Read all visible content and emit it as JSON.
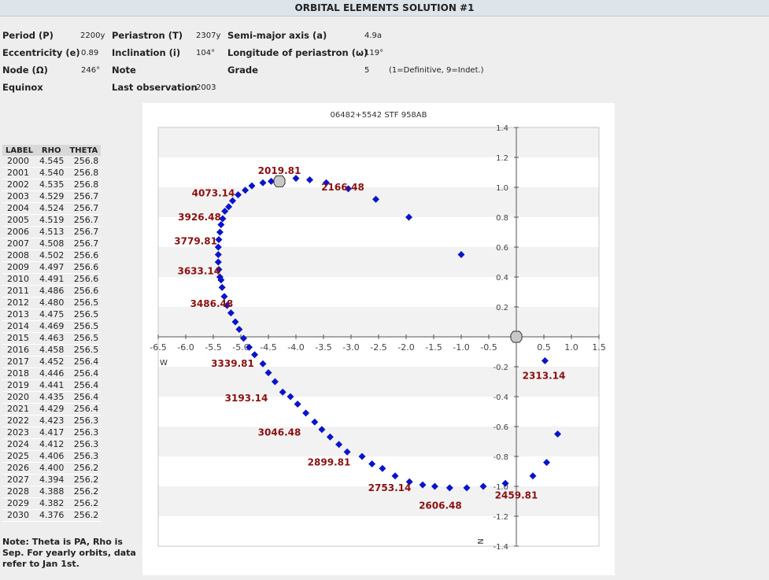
{
  "header": {
    "title": "ORBITAL ELEMENTS SOLUTION #1"
  },
  "elements": {
    "period_label": "Period (P)",
    "period_value": "2200y",
    "periastron_label": "Periastron (T)",
    "periastron_value": "2307y",
    "semimajor_label": "Semi-major axis (a)",
    "semimajor_value": "4.9a",
    "ecc_label": "Eccentricity (e)",
    "ecc_value": "0.89",
    "incl_label": "Inclination (i)",
    "incl_value": "104°",
    "longperi_label": "Longitude of periastron (ω)",
    "longperi_value": "119°",
    "node_label": "Node (Ω)",
    "node_value": "246°",
    "note_label": "Note",
    "grade_label": "Grade",
    "grade_value": "5",
    "grade_note": "(1=Definitive, 9=Indet.)",
    "equinox_label": "Equinox",
    "lastobs_label": "Last observation",
    "lastobs_value": "2003"
  },
  "ephemeris": {
    "headers": [
      "LABEL",
      "RHO",
      "THETA"
    ],
    "rows": [
      [
        "2000",
        "4.545",
        "256.8"
      ],
      [
        "2001",
        "4.540",
        "256.8"
      ],
      [
        "2002",
        "4.535",
        "256.8"
      ],
      [
        "2003",
        "4.529",
        "256.7"
      ],
      [
        "2004",
        "4.524",
        "256.7"
      ],
      [
        "2005",
        "4.519",
        "256.7"
      ],
      [
        "2006",
        "4.513",
        "256.7"
      ],
      [
        "2007",
        "4.508",
        "256.7"
      ],
      [
        "2008",
        "4.502",
        "256.6"
      ],
      [
        "2009",
        "4.497",
        "256.6"
      ],
      [
        "2010",
        "4.491",
        "256.6"
      ],
      [
        "2011",
        "4.486",
        "256.6"
      ],
      [
        "2012",
        "4.480",
        "256.5"
      ],
      [
        "2013",
        "4.475",
        "256.5"
      ],
      [
        "2014",
        "4.469",
        "256.5"
      ],
      [
        "2015",
        "4.463",
        "256.5"
      ],
      [
        "2016",
        "4.458",
        "256.5"
      ],
      [
        "2017",
        "4.452",
        "256.4"
      ],
      [
        "2018",
        "4.446",
        "256.4"
      ],
      [
        "2019",
        "4.441",
        "256.4"
      ],
      [
        "2020",
        "4.435",
        "256.4"
      ],
      [
        "2021",
        "4.429",
        "256.4"
      ],
      [
        "2022",
        "4.423",
        "256.3"
      ],
      [
        "2023",
        "4.417",
        "256.3"
      ],
      [
        "2024",
        "4.412",
        "256.3"
      ],
      [
        "2025",
        "4.406",
        "256.3"
      ],
      [
        "2026",
        "4.400",
        "256.2"
      ],
      [
        "2027",
        "4.394",
        "256.2"
      ],
      [
        "2028",
        "4.388",
        "256.2"
      ],
      [
        "2029",
        "4.382",
        "256.2"
      ],
      [
        "2030",
        "4.376",
        "256.2"
      ]
    ]
  },
  "note": "Note: Theta is PA, Rho is Sep. For yearly orbits, data refer to Jan 1st.",
  "chart_data": {
    "type": "scatter",
    "title": "06482+5542 STF 958AB",
    "xlabel": "W",
    "ylabel": "N",
    "xlim": [
      -6.5,
      1.5
    ],
    "ylim": [
      -1.4,
      1.4
    ],
    "x_ticks": [
      -6.5,
      -6.0,
      -5.5,
      -5.0,
      -4.5,
      -4.0,
      -3.5,
      -3.0,
      -2.5,
      -2.0,
      -1.5,
      -1.0,
      -0.5,
      0.5,
      1.0,
      1.5
    ],
    "x_tick_labels": [
      "-6.5",
      "-6.0",
      "-5.5",
      "-5.0",
      "-4.5",
      "-4.0",
      "-3.5",
      "-3.0",
      "-2.5",
      "-2.0",
      "-1.5",
      "-1.0",
      "-0.5",
      "0.5",
      "1.0",
      "1.5"
    ],
    "y_ticks": [
      1.4,
      1.2,
      1.0,
      0.8,
      0.6,
      0.4,
      0.2,
      -0.2,
      -0.4,
      -0.6,
      -0.8,
      -1.0,
      -1.2,
      -1.4
    ],
    "y_tick_labels": [
      "1.4",
      "1.2",
      "1.0",
      "0.8",
      "0.6",
      "0.4",
      "0.2",
      "-0.2",
      "-0.4",
      "-0.6",
      "-0.8",
      "-1.0",
      "-1.2",
      "-1.4"
    ],
    "primary": [
      0.0,
      0.0
    ],
    "current_position": [
      -4.3,
      1.04
    ],
    "orbit_points": [
      [
        -4.6,
        1.03
      ],
      [
        -4.45,
        1.04
      ],
      [
        -4.0,
        1.06
      ],
      [
        -3.75,
        1.05
      ],
      [
        -3.45,
        1.03
      ],
      [
        -3.05,
        0.99
      ],
      [
        -2.55,
        0.92
      ],
      [
        -1.95,
        0.8
      ],
      [
        -1.0,
        0.55
      ],
      [
        -4.8,
        1.01
      ],
      [
        -4.92,
        0.98
      ],
      [
        -5.05,
        0.95
      ],
      [
        -5.15,
        0.91
      ],
      [
        -5.22,
        0.87
      ],
      [
        -5.29,
        0.84
      ],
      [
        -5.33,
        0.79
      ],
      [
        -5.36,
        0.75
      ],
      [
        -5.38,
        0.7
      ],
      [
        -5.4,
        0.65
      ],
      [
        -5.41,
        0.6
      ],
      [
        -5.41,
        0.55
      ],
      [
        -5.41,
        0.5
      ],
      [
        -5.4,
        0.45
      ],
      [
        -5.38,
        0.4
      ],
      [
        -5.36,
        0.38
      ],
      [
        -5.34,
        0.33
      ],
      [
        -5.3,
        0.27
      ],
      [
        -5.25,
        0.21
      ],
      [
        -5.18,
        0.16
      ],
      [
        -5.1,
        0.1
      ],
      [
        -5.03,
        0.05
      ],
      [
        -4.95,
        -0.01
      ],
      [
        -4.85,
        -0.07
      ],
      [
        -4.75,
        -0.12
      ],
      [
        -4.6,
        -0.18
      ],
      [
        -4.5,
        -0.24
      ],
      [
        -4.38,
        -0.3
      ],
      [
        -4.24,
        -0.37
      ],
      [
        -4.1,
        -0.4
      ],
      [
        -3.97,
        -0.45
      ],
      [
        -3.82,
        -0.51
      ],
      [
        -3.66,
        -0.57
      ],
      [
        -3.53,
        -0.62
      ],
      [
        -3.38,
        -0.67
      ],
      [
        -3.22,
        -0.72
      ],
      [
        -3.07,
        -0.77
      ],
      [
        -2.8,
        -0.8
      ],
      [
        -2.62,
        -0.85
      ],
      [
        -2.43,
        -0.88
      ],
      [
        -2.2,
        -0.93
      ],
      [
        -1.94,
        -0.97
      ],
      [
        -1.7,
        -0.99
      ],
      [
        -1.48,
        -1.0
      ],
      [
        -1.21,
        -1.01
      ],
      [
        -0.9,
        -1.01
      ],
      [
        -0.6,
        -1.0
      ],
      [
        -0.2,
        -0.98
      ],
      [
        0.3,
        -0.93
      ],
      [
        0.55,
        -0.84
      ],
      [
        0.75,
        -0.65
      ],
      [
        0.52,
        -0.16
      ]
    ],
    "annotations": [
      {
        "text": "2019.81",
        "x": -4.3,
        "y": 1.11
      },
      {
        "text": "2166.48",
        "x": -3.15,
        "y": 1.0
      },
      {
        "text": "4073.14",
        "x": -5.5,
        "y": 0.96
      },
      {
        "text": "3926.48",
        "x": -5.75,
        "y": 0.8
      },
      {
        "text": "3779.81",
        "x": -5.82,
        "y": 0.64
      },
      {
        "text": "3633.14",
        "x": -5.76,
        "y": 0.44
      },
      {
        "text": "3486.48",
        "x": -5.53,
        "y": 0.22
      },
      {
        "text": "3339.81",
        "x": -5.15,
        "y": -0.18
      },
      {
        "text": "3193.14",
        "x": -4.9,
        "y": -0.41
      },
      {
        "text": "3046.48",
        "x": -4.3,
        "y": -0.64
      },
      {
        "text": "2899.81",
        "x": -3.4,
        "y": -0.84
      },
      {
        "text": "2753.14",
        "x": -2.3,
        "y": -1.01
      },
      {
        "text": "2606.48",
        "x": -1.38,
        "y": -1.13
      },
      {
        "text": "2459.81",
        "x": 0.0,
        "y": -1.06
      },
      {
        "text": "2313.14",
        "x": 0.5,
        "y": -0.26
      }
    ],
    "colors": {
      "points": "#0a14c8",
      "labels": "#8b1010",
      "band": "#f2f2f2",
      "grid": "#c8c8c8"
    }
  }
}
